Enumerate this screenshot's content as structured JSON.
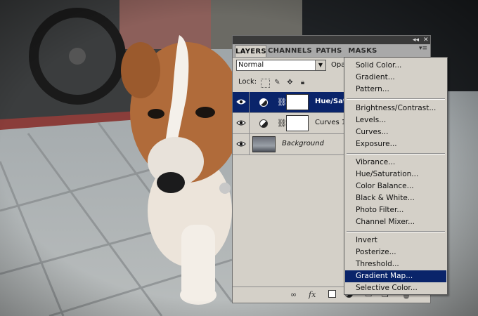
{
  "panel": {
    "tabs": [
      {
        "label": "LAYERS",
        "active": true
      },
      {
        "label": "CHANNELS",
        "active": false
      },
      {
        "label": "PATHS",
        "active": false
      },
      {
        "label": "MASKS",
        "active": false
      }
    ],
    "titlebar": {
      "collapse_glyph": "◂◂",
      "close_glyph": "✕"
    },
    "menu_button_glyph": "▾≡",
    "blend_mode": "Normal",
    "opacity_label": "Opa",
    "lock_label": "Lock:",
    "layers": [
      {
        "name": "Hue/Sat",
        "type": "adjustment",
        "selected": true,
        "visible": true
      },
      {
        "name": "Curves 1",
        "type": "adjustment",
        "selected": false,
        "visible": true
      },
      {
        "name": "Background",
        "type": "image",
        "selected": false,
        "visible": true
      }
    ],
    "bottom_icons": [
      "link-icon",
      "fx-icon",
      "mask-icon",
      "adjustment-icon",
      "group-icon",
      "new-layer-icon",
      "trash-icon"
    ],
    "fx_label": "fx"
  },
  "adjustment_menu": {
    "groups": [
      [
        "Solid Color...",
        "Gradient...",
        "Pattern..."
      ],
      [
        "Brightness/Contrast...",
        "Levels...",
        "Curves...",
        "Exposure..."
      ],
      [
        "Vibrance...",
        "Hue/Saturation...",
        "Color Balance...",
        "Black & White...",
        "Photo Filter...",
        "Channel Mixer..."
      ],
      [
        "Invert",
        "Posterize...",
        "Threshold...",
        "Gradient Map...",
        "Selective Color..."
      ]
    ],
    "highlighted": "Gradient Map..."
  },
  "colors": {
    "selection": "#0a246a",
    "panel_bg": "#d4d0c8"
  }
}
